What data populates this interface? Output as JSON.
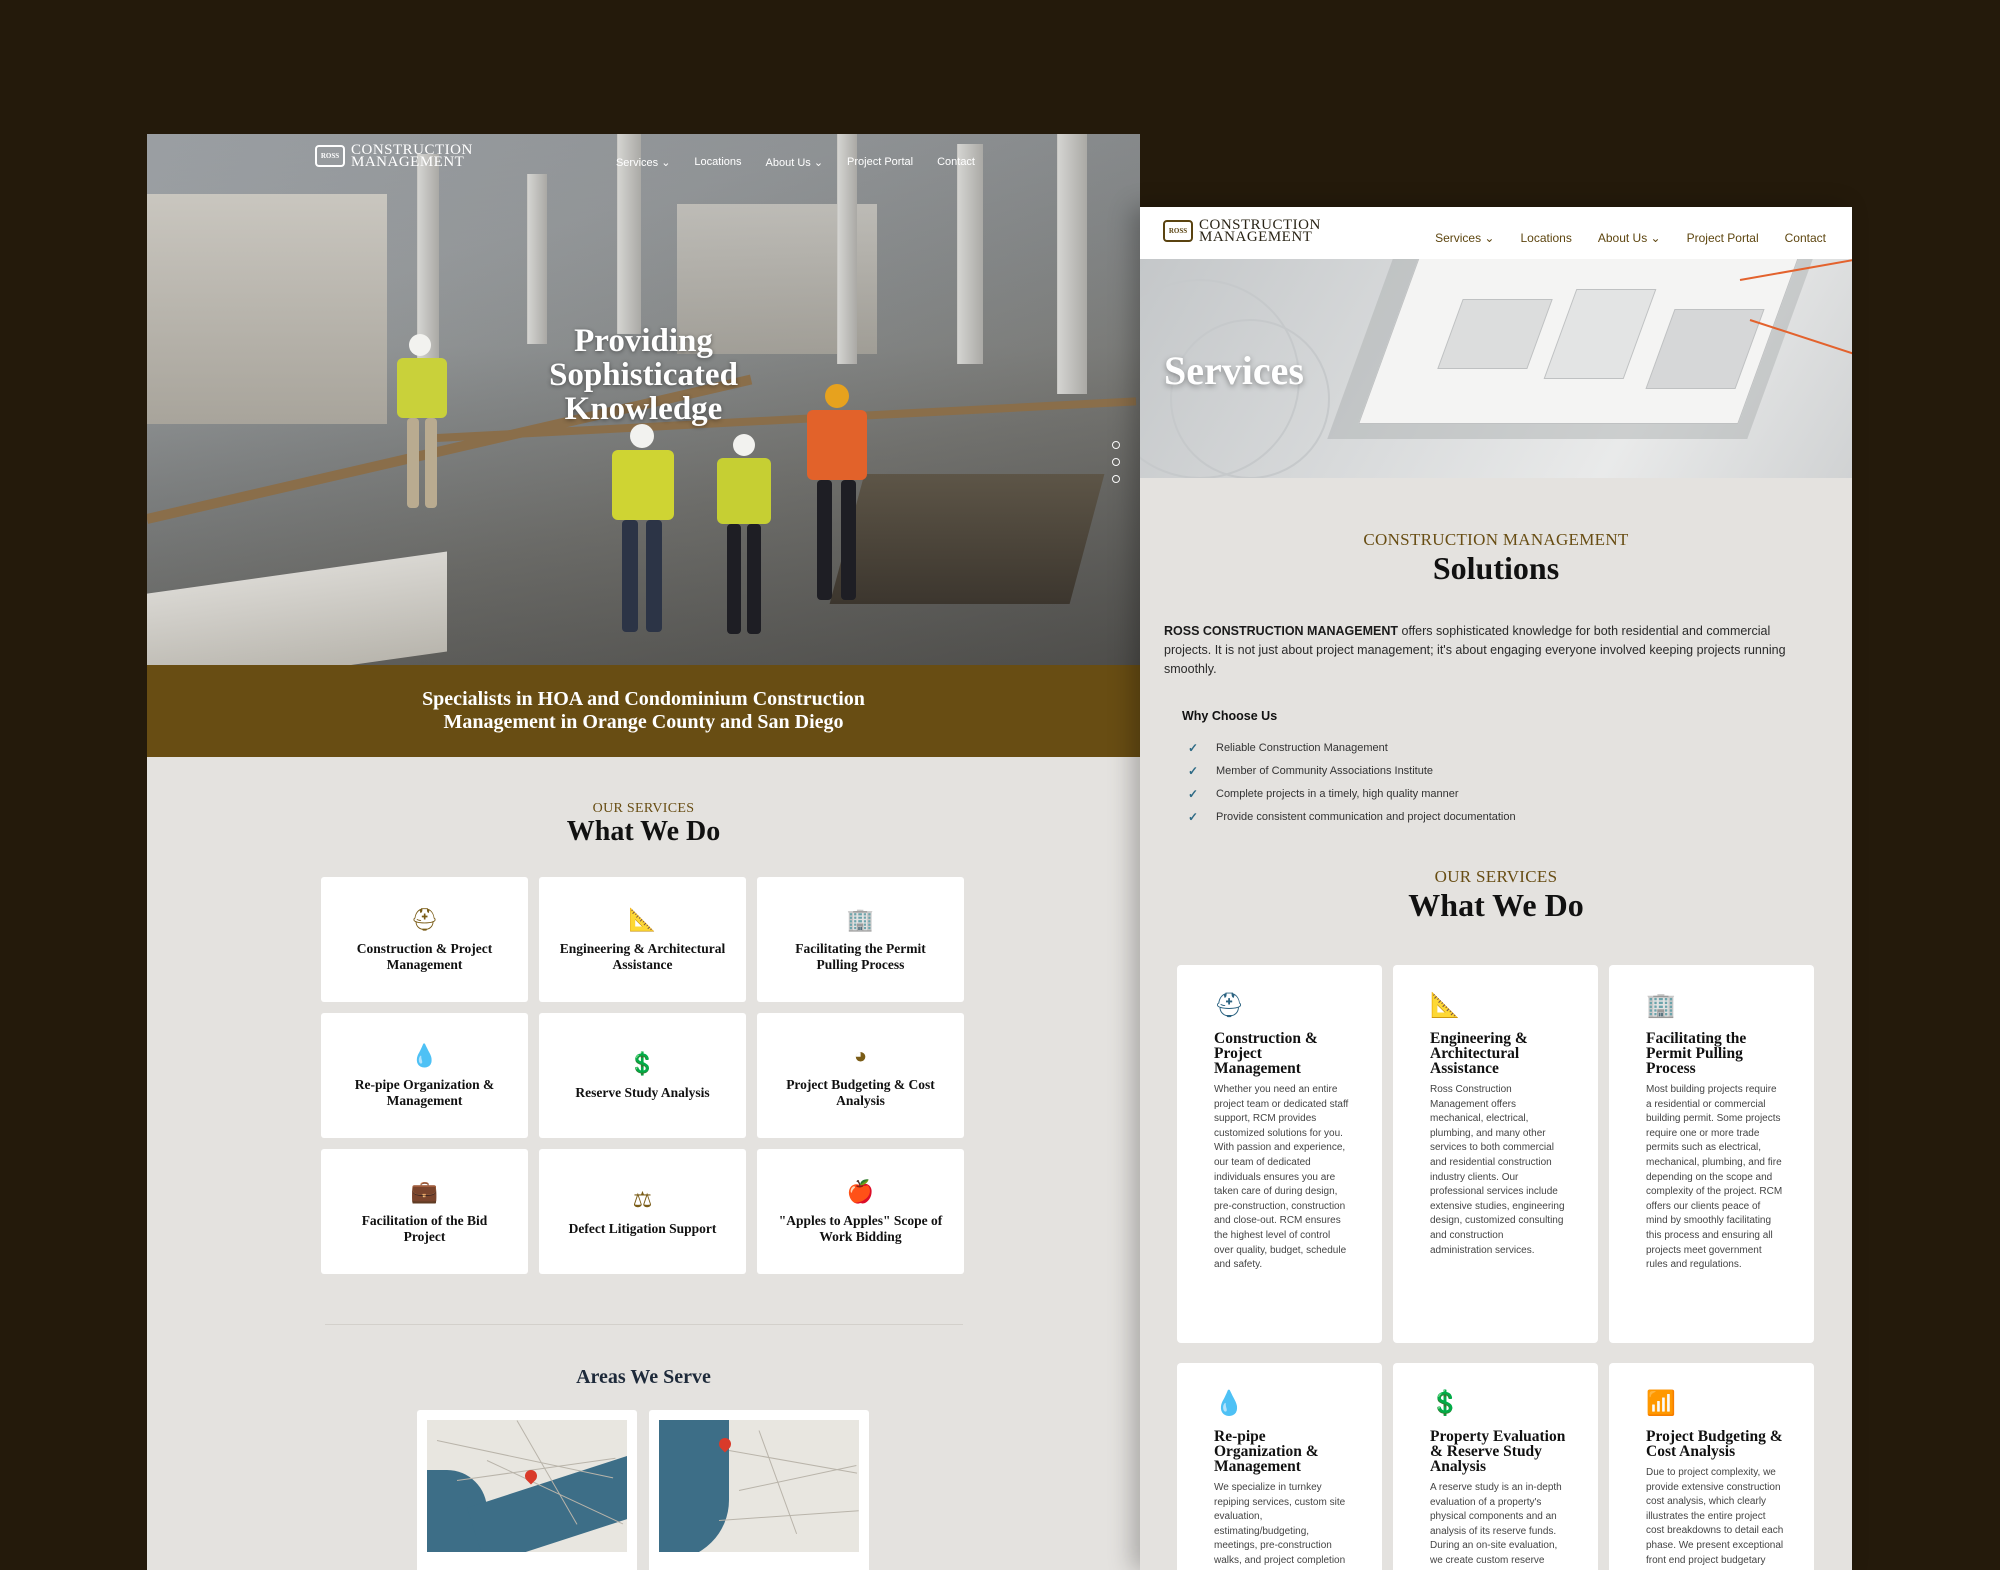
{
  "left": {
    "logo": {
      "badge": "ROSS",
      "line1": "CONSTRUCTION",
      "line2": "MANAGEMENT"
    },
    "nav": [
      "Services ⌄",
      "Locations",
      "About Us ⌄",
      "Project Portal",
      "Contact"
    ],
    "hero_title": "Providing Sophisticated Knowledge",
    "band_text": "Specialists in HOA and Condominium Construction Management in Orange County and San Diego",
    "services_eyebrow": "OUR SERVICES",
    "services_title": "What We Do",
    "services": [
      {
        "icon": "hard-hat-icon",
        "glyph": "⛑",
        "label": "Construction & Project Management"
      },
      {
        "icon": "compass-icon",
        "glyph": "📐",
        "label": "Engineering & Architectural Assistance"
      },
      {
        "icon": "building-icon",
        "glyph": "🏢",
        "label": "Facilitating the Permit Pulling Process"
      },
      {
        "icon": "hand-drop-icon",
        "glyph": "💧",
        "label": "Re-pipe Organization & Management"
      },
      {
        "icon": "dollar-icon",
        "glyph": "💲",
        "label": "Reserve Study Analysis"
      },
      {
        "icon": "pie-chart-icon",
        "glyph": "◕",
        "label": "Project Budgeting & Cost Analysis"
      },
      {
        "icon": "briefcase-clock-icon",
        "glyph": "💼",
        "label": "Facilitation of the Bid Project"
      },
      {
        "icon": "scales-icon",
        "glyph": "⚖",
        "label": "Defect Litigation Support"
      },
      {
        "icon": "apple-icon",
        "glyph": "🍎",
        "label": "\"Apples to Apples\" Scope of Work Bidding"
      }
    ],
    "areas_title": "Areas We Serve"
  },
  "right": {
    "logo": {
      "badge": "ROSS",
      "line1": "CONSTRUCTION",
      "line2": "MANAGEMENT"
    },
    "nav": [
      "Services ⌄",
      "Locations",
      "About Us ⌄",
      "Project Portal",
      "Contact"
    ],
    "banner_title": "Services",
    "solutions_eyebrow": "CONSTRUCTION MANAGEMENT",
    "solutions_title": "Solutions",
    "intro_bold": "ROSS CONSTRUCTION MANAGEMENT",
    "intro_rest": " offers sophisticated knowledge for both residential and commercial projects. It is not just about project management; it's about engaging everyone involved keeping projects running smoothly.",
    "why_title": "Why Choose Us",
    "why_items": [
      "Reliable Construction Management",
      "Member of Community Associations Institute",
      "Complete projects in a timely, high quality manner",
      "Provide consistent communication and project documentation"
    ],
    "check_glyph": "✓",
    "services_eyebrow": "OUR SERVICES",
    "services_title": "What We Do",
    "services": [
      {
        "icon": "hard-hat-icon",
        "glyph": "⛑",
        "title": "Construction & Project Management",
        "desc": "Whether you need an entire project team or dedicated staff support, RCM provides customized solutions for you. With passion and experience, our team of dedicated individuals ensures you are taken care of during design, pre-construction, construction and close-out. RCM ensures the highest level of control over quality, budget, schedule and safety."
      },
      {
        "icon": "compass-icon",
        "glyph": "📐",
        "title": "Engineering & Architectural Assistance",
        "desc": "Ross Construction Management offers mechanical, electrical, plumbing, and many other services to both commercial and residential construction industry clients. Our professional services include extensive studies, engineering design, customized consulting and construction administration services."
      },
      {
        "icon": "building-icon",
        "glyph": "🏢",
        "title": "Facilitating the Permit Pulling Process",
        "desc": "Most building projects require a residential or commercial building permit. Some projects require one or more trade permits such as electrical, mechanical, plumbing, and fire depending on the scope and complexity of the project. RCM offers our clients peace of mind by smoothly facilitating this process and ensuring all projects meet government rules and regulations."
      },
      {
        "icon": "hand-drop-icon",
        "glyph": "💧",
        "title": "Re-pipe Organization & Management",
        "desc": "We specialize in turnkey repiping services, custom site evaluation, estimating/budgeting, meetings, pre-construction walks, and project completion follow-up. We are fully involved in all project processes ensuring clear"
      },
      {
        "icon": "dollar-icon",
        "glyph": "💲",
        "title": "Property Evaluation & Reserve Study Analysis",
        "desc": "A reserve study is an in-depth evaluation of a property's physical components and an analysis of its reserve funds. During an on-site evaluation, we create custom reserve study"
      },
      {
        "icon": "signal-bars-icon",
        "glyph": "📶",
        "title": "Project Budgeting & Cost Analysis",
        "desc": "Due to project complexity, we provide extensive construction cost analysis, which clearly illustrates the entire project cost breakdowns to detail each phase. We present exceptional front end project budgetary"
      }
    ]
  }
}
